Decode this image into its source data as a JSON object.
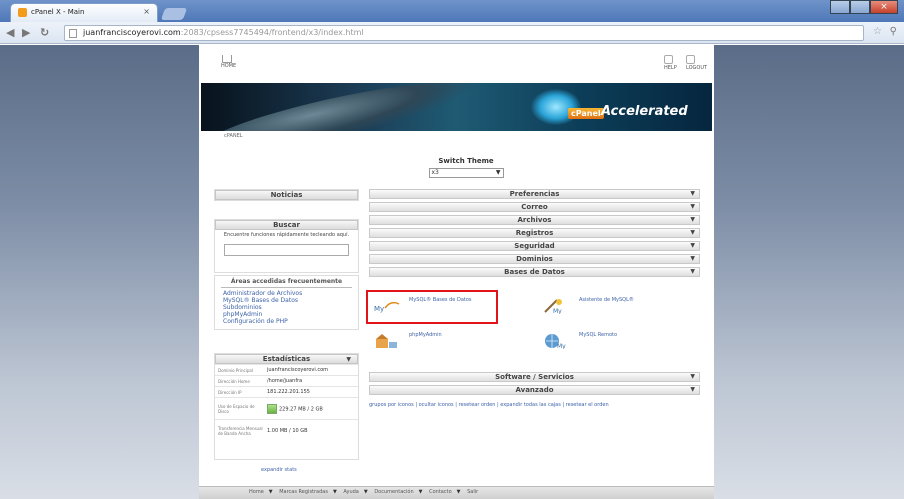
{
  "browser": {
    "tab_title": "cPanel X - Main",
    "tab_close": "×",
    "url_host": "juanfranciscoyerovi.com",
    "url_path": ":2083/cpsess7745494/frontend/x3/index.html",
    "star": "☆",
    "wrench": "⚲"
  },
  "topbar": {
    "home_label": "HOME",
    "help_label": "HELP",
    "logout_label": "LOGOUT"
  },
  "banner": {
    "logo_cp": "cPanel",
    "logo_acc": "Accelerated"
  },
  "breadcrumb": "cPANEL",
  "switch_theme": {
    "label": "Switch Theme",
    "selected": "x3"
  },
  "left": {
    "news_title": "Noticias",
    "find_title": "Buscar",
    "find_hint": "Encuentre funciones rápidamente tecleando aquí.",
    "most_title": "Áreas accedidas frecuentemente",
    "most_links": [
      "Administrador de Archivos",
      "MySQL® Bases de Datos",
      "Subdominios",
      "phpMyAdmin",
      "Configuración de PHP"
    ],
    "stats_title": "Estadísticas",
    "stats": [
      {
        "k": "Dominio Principal",
        "v": "juanfranciscoyerovi.com"
      },
      {
        "k": "Dirección Home",
        "v": "/home/juanfra"
      },
      {
        "k": "Dirección IP",
        "v": "181.222.201.155"
      },
      {
        "k": "Uso de Espacio de Disco",
        "v": "229.27 MB / 2 GB"
      },
      {
        "k": "Transferencia Mensual de Banda Ancha",
        "v": "1.00 MB / 10 GB"
      }
    ],
    "expand": "expandir stats"
  },
  "right": {
    "rows_top": [
      "Preferencias",
      "Correo",
      "Archivos",
      "Registros",
      "Seguridad",
      "Dominios",
      "Bases de Datos"
    ],
    "db_items": [
      "MySQL® Bases de Datos",
      "Asistente de MySQL®",
      "phpMyAdmin",
      "MySQL Remoto"
    ],
    "rows_bottom": [
      "Software / Servicios",
      "Avanzado"
    ],
    "arrow": "▼",
    "bottom_links": "grupos por iconos | ocultar iconos | resetear orden | expandir todas las cajas | resetear el orden"
  },
  "footer": [
    "Home",
    "Marcas Registradas",
    "Ayuda",
    "Documentación",
    "Contacto",
    "Salir"
  ]
}
